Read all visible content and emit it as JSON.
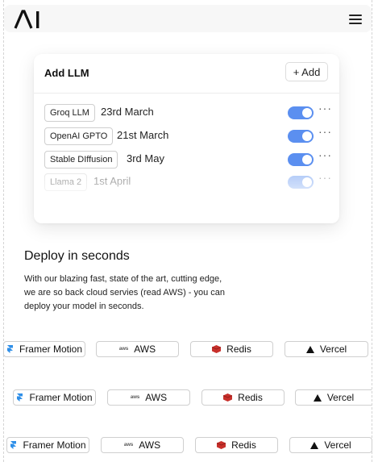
{
  "header": {
    "logo_text": "AI"
  },
  "card": {
    "title": "Add LLM",
    "add_label": "+ Add",
    "rows": [
      {
        "tag": "Groq LLM",
        "date": "23rd March",
        "enabled": true
      },
      {
        "tag": "OpenAI GPTO",
        "date": "21st March",
        "enabled": true
      },
      {
        "tag": "Stable DIffusion",
        "date": "3rd May",
        "enabled": true
      },
      {
        "tag": "Llama 2",
        "date": "1st April",
        "enabled": true
      }
    ]
  },
  "deploy": {
    "title": "Deploy in seconds",
    "text": "With our blazing fast, state of the art, cutting edge, we are so back cloud servies (read AWS) - you can deploy your model in seconds."
  },
  "tech": {
    "framer": "Framer Motion",
    "aws": "AWS",
    "aws_icon": "aws",
    "redis": "Redis",
    "vercel": "Vercel"
  },
  "colors": {
    "toggle": "#5b8ff0",
    "redis": "#c8302b",
    "framer": "#2f8fe8"
  }
}
